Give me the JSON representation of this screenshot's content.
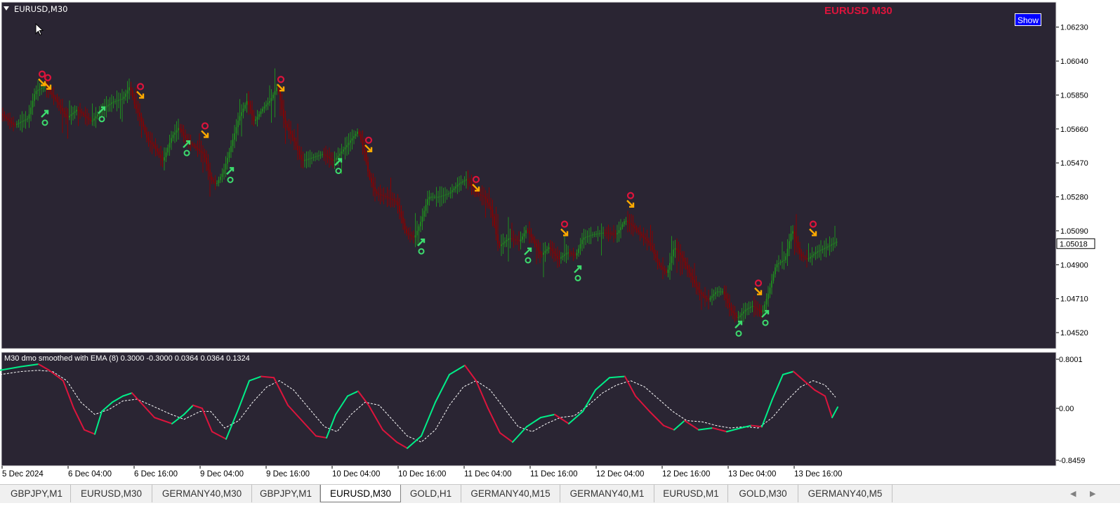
{
  "window": {
    "symbol_label": "EURUSD,M30",
    "chart_title": "EURUSD M30",
    "show_button_label": "Show",
    "colors": {
      "background": "#2a2533",
      "bull": "#1f8f1f",
      "bear": "#8b0000",
      "osc_up": "#00ee88",
      "osc_down": "#dc143c",
      "signal": "#ffffff",
      "title": "#dc143c"
    }
  },
  "price_axis": {
    "labels": [
      "1.06230",
      "1.06040",
      "1.05850",
      "1.05660",
      "1.05470",
      "1.05280",
      "1.05090",
      "1.04900",
      "1.04710",
      "1.04520"
    ],
    "current_price": "1.05018"
  },
  "indicator": {
    "label": "M30 dmo smoothed with EMA (8) 0.3000 -0.3000 0.0364 0.0364 0.1324",
    "axis_labels": [
      "0.8001",
      "0.00",
      "-0.8459"
    ]
  },
  "time_axis": {
    "labels": [
      "5 Dec 2024",
      "6 Dec 04:00",
      "6 Dec 16:00",
      "9 Dec 04:00",
      "9 Dec 16:00",
      "10 Dec 04:00",
      "10 Dec 16:00",
      "11 Dec 04:00",
      "11 Dec 16:00",
      "12 Dec 04:00",
      "12 Dec 16:00",
      "13 Dec 04:00",
      "13 Dec 16:00"
    ]
  },
  "tabs": [
    {
      "label": "GBPJPY,M1",
      "active": false
    },
    {
      "label": "EURUSD,M30",
      "active": false
    },
    {
      "label": "GERMANY40,M30",
      "active": false
    },
    {
      "label": "GBPJPY,M1",
      "active": false
    },
    {
      "label": "EURUSD,M30",
      "active": true
    },
    {
      "label": "GOLD,H1",
      "active": false
    },
    {
      "label": "GERMANY40,M15",
      "active": false
    },
    {
      "label": "GERMANY40,M1",
      "active": false
    },
    {
      "label": "EURUSD,M1",
      "active": false
    },
    {
      "label": "GOLD,M30",
      "active": false
    },
    {
      "label": "GERMANY40,M5",
      "active": false
    }
  ],
  "chart_data": {
    "type": "candlestick",
    "price_path": [
      [
        0,
        1.0575
      ],
      [
        20,
        1.0568
      ],
      [
        40,
        1.0572
      ],
      [
        50,
        1.0587
      ],
      [
        65,
        1.059
      ],
      [
        80,
        1.0582
      ],
      [
        95,
        1.0572
      ],
      [
        110,
        1.0577
      ],
      [
        130,
        1.057
      ],
      [
        145,
        1.0577
      ],
      [
        160,
        1.0581
      ],
      [
        175,
        1.0583
      ],
      [
        185,
        1.059
      ],
      [
        192,
        1.0579
      ],
      [
        200,
        1.0572
      ],
      [
        210,
        1.056
      ],
      [
        220,
        1.0556
      ],
      [
        232,
        1.0548
      ],
      [
        245,
        1.0562
      ],
      [
        255,
        1.0567
      ],
      [
        265,
        1.056
      ],
      [
        280,
        1.0555
      ],
      [
        290,
        1.0552
      ],
      [
        300,
        1.0538
      ],
      [
        308,
        1.0535
      ],
      [
        318,
        1.0542
      ],
      [
        328,
        1.0555
      ],
      [
        340,
        1.0572
      ],
      [
        352,
        1.0582
      ],
      [
        362,
        1.057
      ],
      [
        375,
        1.0578
      ],
      [
        385,
        1.0582
      ],
      [
        395,
        1.059
      ],
      [
        405,
        1.057
      ],
      [
        418,
        1.056
      ],
      [
        430,
        1.0548
      ],
      [
        445,
        1.055
      ],
      [
        460,
        1.0552
      ],
      [
        475,
        1.0548
      ],
      [
        490,
        1.0555
      ],
      [
        500,
        1.056
      ],
      [
        510,
        1.0565
      ],
      [
        518,
        1.0555
      ],
      [
        525,
        1.054
      ],
      [
        535,
        1.053
      ],
      [
        550,
        1.0528
      ],
      [
        565,
        1.0525
      ],
      [
        578,
        1.0508
      ],
      [
        590,
        1.0505
      ],
      [
        600,
        1.0515
      ],
      [
        610,
        1.0528
      ],
      [
        625,
        1.0528
      ],
      [
        640,
        1.053
      ],
      [
        652,
        1.0535
      ],
      [
        665,
        1.0538
      ],
      [
        678,
        1.053
      ],
      [
        690,
        1.0528
      ],
      [
        700,
        1.052
      ],
      [
        710,
        1.05
      ],
      [
        725,
        1.0505
      ],
      [
        740,
        1.0503
      ],
      [
        750,
        1.051
      ],
      [
        760,
        1.0503
      ],
      [
        770,
        1.0495
      ],
      [
        782,
        1.05
      ],
      [
        795,
        1.0493
      ],
      [
        808,
        1.0497
      ],
      [
        820,
        1.0495
      ],
      [
        830,
        1.0505
      ],
      [
        845,
        1.0507
      ],
      [
        860,
        1.0508
      ],
      [
        878,
        1.0507
      ],
      [
        890,
        1.0515
      ],
      [
        900,
        1.0512
      ],
      [
        912,
        1.0507
      ],
      [
        925,
        1.0502
      ],
      [
        938,
        1.049
      ],
      [
        950,
        1.0485
      ],
      [
        960,
        1.05
      ],
      [
        970,
        1.0495
      ],
      [
        982,
        1.0485
      ],
      [
        995,
        1.0475
      ],
      [
        1008,
        1.047
      ],
      [
        1020,
        1.0475
      ],
      [
        1030,
        1.0475
      ],
      [
        1040,
        1.0465
      ],
      [
        1050,
        1.046
      ],
      [
        1062,
        1.0465
      ],
      [
        1072,
        1.0467
      ],
      [
        1085,
        1.0463
      ],
      [
        1095,
        1.0475
      ],
      [
        1105,
        1.049
      ],
      [
        1118,
        1.0493
      ],
      [
        1128,
        1.051
      ],
      [
        1140,
        1.0495
      ],
      [
        1150,
        1.0493
      ],
      [
        1162,
        1.0497
      ],
      [
        1178,
        1.05
      ],
      [
        1192,
        1.0503
      ]
    ],
    "signals": [
      {
        "x": 60,
        "price": 1.0592,
        "dir": "down"
      },
      {
        "x": 68,
        "price": 1.059,
        "dir": "down"
      },
      {
        "x": 200,
        "price": 1.0585,
        "dir": "down"
      },
      {
        "x": 292,
        "price": 1.0563,
        "dir": "down"
      },
      {
        "x": 400,
        "price": 1.0589,
        "dir": "down"
      },
      {
        "x": 525,
        "price": 1.0555,
        "dir": "down"
      },
      {
        "x": 678,
        "price": 1.0533,
        "dir": "down"
      },
      {
        "x": 804,
        "price": 1.0508,
        "dir": "down"
      },
      {
        "x": 898,
        "price": 1.0524,
        "dir": "down"
      },
      {
        "x": 1080,
        "price": 1.0475,
        "dir": "down"
      },
      {
        "x": 1158,
        "price": 1.0508,
        "dir": "down"
      },
      {
        "x": 64,
        "price": 1.0575,
        "dir": "up"
      },
      {
        "x": 145,
        "price": 1.0577,
        "dir": "up"
      },
      {
        "x": 266,
        "price": 1.0558,
        "dir": "up"
      },
      {
        "x": 328,
        "price": 1.0543,
        "dir": "up"
      },
      {
        "x": 482,
        "price": 1.0548,
        "dir": "up"
      },
      {
        "x": 600,
        "price": 1.0503,
        "dir": "up"
      },
      {
        "x": 752,
        "price": 1.0498,
        "dir": "up"
      },
      {
        "x": 823,
        "price": 1.0488,
        "dir": "up"
      },
      {
        "x": 1052,
        "price": 1.0457,
        "dir": "up"
      },
      {
        "x": 1090,
        "price": 1.0463,
        "dir": "up"
      }
    ],
    "ylim": [
      1.0443,
      1.0637
    ],
    "oscillator": {
      "ylim": [
        -0.8459,
        0.8001
      ],
      "dmo": [
        [
          0,
          0.62
        ],
        [
          30,
          0.68
        ],
        [
          55,
          0.72
        ],
        [
          70,
          0.62
        ],
        [
          90,
          0.45
        ],
        [
          105,
          0.0
        ],
        [
          120,
          -0.35
        ],
        [
          135,
          -0.42
        ],
        [
          145,
          -0.05
        ],
        [
          160,
          0.1
        ],
        [
          175,
          0.2
        ],
        [
          188,
          0.25
        ],
        [
          200,
          0.1
        ],
        [
          220,
          -0.15
        ],
        [
          245,
          -0.25
        ],
        [
          262,
          -0.1
        ],
        [
          275,
          0.05
        ],
        [
          288,
          0.0
        ],
        [
          302,
          -0.38
        ],
        [
          322,
          -0.5
        ],
        [
          340,
          0.0
        ],
        [
          355,
          0.45
        ],
        [
          372,
          0.52
        ],
        [
          390,
          0.5
        ],
        [
          410,
          0.05
        ],
        [
          430,
          -0.2
        ],
        [
          450,
          -0.45
        ],
        [
          465,
          -0.48
        ],
        [
          478,
          -0.1
        ],
        [
          495,
          0.2
        ],
        [
          510,
          0.28
        ],
        [
          525,
          0.05
        ],
        [
          545,
          -0.35
        ],
        [
          565,
          -0.55
        ],
        [
          580,
          -0.65
        ],
        [
          600,
          -0.45
        ],
        [
          620,
          0.1
        ],
        [
          640,
          0.55
        ],
        [
          662,
          0.7
        ],
        [
          678,
          0.45
        ],
        [
          695,
          0.0
        ],
        [
          712,
          -0.4
        ],
        [
          730,
          -0.55
        ],
        [
          750,
          -0.3
        ],
        [
          770,
          -0.15
        ],
        [
          790,
          -0.1
        ],
        [
          810,
          -0.25
        ],
        [
          830,
          -0.05
        ],
        [
          848,
          0.3
        ],
        [
          868,
          0.5
        ],
        [
          890,
          0.52
        ],
        [
          905,
          0.2
        ],
        [
          925,
          -0.05
        ],
        [
          945,
          -0.28
        ],
        [
          960,
          -0.35
        ],
        [
          975,
          -0.2
        ],
        [
          995,
          -0.35
        ],
        [
          1015,
          -0.32
        ],
        [
          1035,
          -0.38
        ],
        [
          1055,
          -0.32
        ],
        [
          1070,
          -0.28
        ],
        [
          1085,
          -0.3
        ],
        [
          1100,
          0.15
        ],
        [
          1115,
          0.55
        ],
        [
          1130,
          0.6
        ],
        [
          1145,
          0.45
        ],
        [
          1160,
          0.3
        ],
        [
          1175,
          0.2
        ],
        [
          1185,
          -0.15
        ],
        [
          1193,
          0.02
        ]
      ],
      "signal": [
        [
          0,
          0.55
        ],
        [
          30,
          0.6
        ],
        [
          55,
          0.62
        ],
        [
          75,
          0.6
        ],
        [
          95,
          0.45
        ],
        [
          115,
          0.1
        ],
        [
          135,
          -0.1
        ],
        [
          155,
          -0.02
        ],
        [
          175,
          0.12
        ],
        [
          195,
          0.15
        ],
        [
          215,
          0.05
        ],
        [
          240,
          -0.08
        ],
        [
          262,
          -0.18
        ],
        [
          285,
          -0.05
        ],
        [
          300,
          -0.05
        ],
        [
          320,
          -0.32
        ],
        [
          340,
          -0.2
        ],
        [
          360,
          0.1
        ],
        [
          380,
          0.35
        ],
        [
          398,
          0.45
        ],
        [
          418,
          0.3
        ],
        [
          440,
          0.0
        ],
        [
          462,
          -0.3
        ],
        [
          480,
          -0.38
        ],
        [
          500,
          -0.1
        ],
        [
          520,
          0.1
        ],
        [
          540,
          0.05
        ],
        [
          560,
          -0.2
        ],
        [
          580,
          -0.45
        ],
        [
          600,
          -0.55
        ],
        [
          620,
          -0.35
        ],
        [
          640,
          0.05
        ],
        [
          660,
          0.35
        ],
        [
          678,
          0.45
        ],
        [
          698,
          0.3
        ],
        [
          718,
          0.0
        ],
        [
          738,
          -0.3
        ],
        [
          758,
          -0.38
        ],
        [
          778,
          -0.25
        ],
        [
          798,
          -0.15
        ],
        [
          818,
          -0.12
        ],
        [
          838,
          0.05
        ],
        [
          858,
          0.25
        ],
        [
          878,
          0.38
        ],
        [
          898,
          0.45
        ],
        [
          918,
          0.35
        ],
        [
          938,
          0.15
        ],
        [
          958,
          -0.05
        ],
        [
          978,
          -0.2
        ],
        [
          1000,
          -0.22
        ],
        [
          1020,
          -0.28
        ],
        [
          1040,
          -0.32
        ],
        [
          1060,
          -0.3
        ],
        [
          1080,
          -0.32
        ],
        [
          1100,
          -0.15
        ],
        [
          1120,
          0.12
        ],
        [
          1140,
          0.35
        ],
        [
          1158,
          0.45
        ],
        [
          1175,
          0.38
        ],
        [
          1190,
          0.18
        ]
      ]
    }
  }
}
